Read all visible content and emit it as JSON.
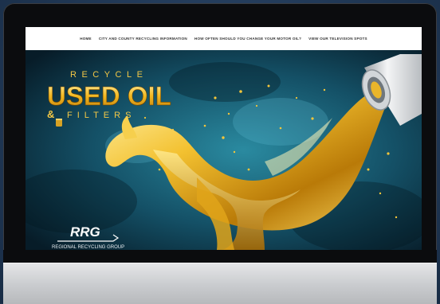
{
  "nav": {
    "items": [
      "HOME",
      "CITY AND COUNTY RECYCLING INFORMATION",
      "HOW OFTEN SHOULD YOU CHANGE YOUR MOTOR OIL?",
      "VIEW OUR TELEVISION SPOTS"
    ]
  },
  "hero": {
    "line1": "RECYCLE",
    "line2": "USED OIL",
    "line3_amp": "&",
    "line3": "FILTERS"
  },
  "logo": {
    "mark": "RRG",
    "name": "REGIONAL RECYCLING GROUP"
  },
  "colors": {
    "gold": "#f0b51c",
    "water": "#1d6f86",
    "nav_bg": "#ffffff"
  }
}
